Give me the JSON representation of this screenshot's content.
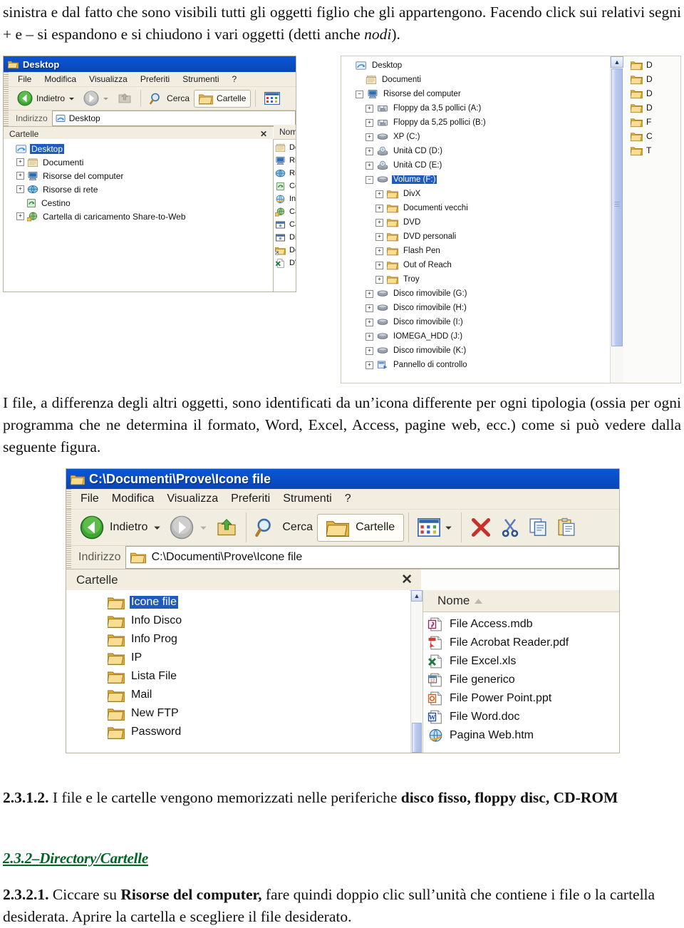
{
  "document": {
    "paragraph1": "sinistra e dal fatto che sono visibili tutti gli oggetti figlio che gli appartengono. Facendo click sui relativi segni + e – si espandono e si chiudono i vari oggetti (detti anche ",
    "paragraph1_italic": "nodi",
    "paragraph1_end": ").",
    "paragraph2_a": "I file, a differenza degli altri oggetti, sono identificati da un’icona differente per ogni tipologia (ossia per ogni programma che ne determina il formato, Word, Excel, Access, pagine web, ecc.) come si può vedere dalla seguente figura.",
    "clause_2312_num": "2.3.1.2.",
    "clause_2312_text": " I file e le cartelle vengono memorizzati nelle periferiche ",
    "clause_2312_bold": "disco fisso, floppy disc, CD-ROM",
    "heading_232": "2.3.2–Directory/Cartelle",
    "heading_232_color": "#006622",
    "clause_2321_num": "2.3.2.1.",
    "clause_2321_a": " Ciccare su ",
    "clause_2321_bold": "Risorse del computer,",
    "clause_2321_b": " fare quindi doppio clic sull’unità che contiene i file o la cartella desiderata. Aprire la cartella e scegliere il file desiderato."
  },
  "figure1": {
    "title": "Desktop",
    "menu": [
      "File",
      "Modifica",
      "Visualizza",
      "Preferiti",
      "Strumenti",
      "?"
    ],
    "toolbar": {
      "back": "Indietro",
      "search": "Cerca",
      "folders": "Cartelle"
    },
    "address": {
      "label": "Indirizzo",
      "value": "Desktop"
    },
    "pane_title": "Cartelle",
    "close_label": "✕",
    "column_header": "Nom",
    "tree": [
      {
        "label": "Desktop",
        "indent": 0,
        "toggle": "none",
        "icon": "desktop-icon",
        "selected": true
      },
      {
        "label": "Documenti",
        "indent": 1,
        "toggle": "+",
        "icon": "documents-icon",
        "selected": false
      },
      {
        "label": "Risorse del computer",
        "indent": 1,
        "toggle": "+",
        "icon": "mycomputer-icon",
        "selected": false
      },
      {
        "label": "Risorse di rete",
        "indent": 1,
        "toggle": "+",
        "icon": "network-icon",
        "selected": false
      },
      {
        "label": "Cestino",
        "indent": 1,
        "toggle": "none",
        "icon": "recyclebin-icon",
        "selected": false
      },
      {
        "label": "Cartella di caricamento Share-to-Web",
        "indent": 1,
        "toggle": "+",
        "icon": "sharetoweb-icon",
        "selected": false
      }
    ],
    "clipped_list": [
      {
        "label": "Do",
        "icon": "documents-icon"
      },
      {
        "label": "Ris",
        "icon": "mycomputer-icon"
      },
      {
        "label": "Ris",
        "icon": "network-icon"
      },
      {
        "label": "Ce",
        "icon": "recyclebin-icon"
      },
      {
        "label": "Int",
        "icon": "internet-icon"
      },
      {
        "label": "Ca",
        "icon": "sharetoweb-icon"
      },
      {
        "label": "Ca",
        "icon": "shortcut-window-icon"
      },
      {
        "label": "Dis",
        "icon": "shortcut-window-icon"
      },
      {
        "label": "Do",
        "icon": "folder-shortcut-icon"
      },
      {
        "label": "DV",
        "icon": "excel-icon"
      }
    ]
  },
  "figure2": {
    "tree": [
      {
        "label": "Desktop",
        "indent": 0,
        "toggle": "none",
        "icon": "desktop-icon",
        "selected": false
      },
      {
        "label": "Documenti",
        "indent": 1,
        "toggle": "none",
        "icon": "documents-icon",
        "selected": false
      },
      {
        "label": "Risorse del computer",
        "indent": 1,
        "toggle": "-",
        "icon": "mycomputer-icon",
        "selected": false
      },
      {
        "label": "Floppy da 3,5 pollici (A:)",
        "indent": 2,
        "toggle": "+",
        "icon": "floppy-icon",
        "selected": false
      },
      {
        "label": "Floppy da 5,25 pollici (B:)",
        "indent": 2,
        "toggle": "+",
        "icon": "floppy-icon",
        "selected": false
      },
      {
        "label": "XP (C:)",
        "indent": 2,
        "toggle": "+",
        "icon": "harddisk-icon",
        "selected": false
      },
      {
        "label": "Unità CD (D:)",
        "indent": 2,
        "toggle": "+",
        "icon": "cddrive-icon",
        "selected": false
      },
      {
        "label": "Unità CD (E:)",
        "indent": 2,
        "toggle": "+",
        "icon": "cddrive-icon",
        "selected": false
      },
      {
        "label": "Volume (F:)",
        "indent": 2,
        "toggle": "-",
        "icon": "harddisk-icon",
        "selected": true
      },
      {
        "label": "DivX",
        "indent": 3,
        "toggle": "+",
        "icon": "folder-icon",
        "selected": false
      },
      {
        "label": "Documenti vecchi",
        "indent": 3,
        "toggle": "+",
        "icon": "folder-icon",
        "selected": false
      },
      {
        "label": "DVD",
        "indent": 3,
        "toggle": "+",
        "icon": "folder-icon",
        "selected": false
      },
      {
        "label": "DVD personali",
        "indent": 3,
        "toggle": "+",
        "icon": "folder-icon",
        "selected": false
      },
      {
        "label": "Flash Pen",
        "indent": 3,
        "toggle": "+",
        "icon": "folder-icon",
        "selected": false
      },
      {
        "label": "Out of Reach",
        "indent": 3,
        "toggle": "+",
        "icon": "folder-icon",
        "selected": false
      },
      {
        "label": "Troy",
        "indent": 3,
        "toggle": "+",
        "icon": "folder-icon",
        "selected": false
      },
      {
        "label": "Disco rimovibile (G:)",
        "indent": 2,
        "toggle": "+",
        "icon": "harddisk-icon",
        "selected": false
      },
      {
        "label": "Disco rimovibile (H:)",
        "indent": 2,
        "toggle": "+",
        "icon": "harddisk-icon",
        "selected": false
      },
      {
        "label": "Disco rimovibile (I:)",
        "indent": 2,
        "toggle": "+",
        "icon": "harddisk-icon",
        "selected": false
      },
      {
        "label": "IOMEGA_HDD (J:)",
        "indent": 2,
        "toggle": "+",
        "icon": "harddisk-icon",
        "selected": false
      },
      {
        "label": "Disco rimovibile (K:)",
        "indent": 2,
        "toggle": "+",
        "icon": "harddisk-icon",
        "selected": false
      },
      {
        "label": "Pannello di controllo",
        "indent": 2,
        "toggle": "+",
        "icon": "controlpanel-icon",
        "selected": false
      }
    ],
    "clipped_list": [
      {
        "label": "D",
        "icon": "folder-icon"
      },
      {
        "label": "D",
        "icon": "folder-icon"
      },
      {
        "label": "D",
        "icon": "folder-icon"
      },
      {
        "label": "D",
        "icon": "folder-icon"
      },
      {
        "label": "F",
        "icon": "folder-icon"
      },
      {
        "label": "C",
        "icon": "folder-icon"
      },
      {
        "label": "T",
        "icon": "folder-icon"
      }
    ]
  },
  "figure3": {
    "title": "C:\\Documenti\\Prove\\Icone file",
    "menu": [
      "File",
      "Modifica",
      "Visualizza",
      "Preferiti",
      "Strumenti",
      "?"
    ],
    "toolbar": {
      "back": "Indietro",
      "search": "Cerca",
      "folders": "Cartelle"
    },
    "address": {
      "label": "Indirizzo",
      "value": "C:\\Documenti\\Prove\\Icone file"
    },
    "pane_title": "Cartelle",
    "close_label": "✕",
    "column_header": "Nome",
    "tree": [
      {
        "label": "Icone file",
        "icon": "folder-icon",
        "selected": true
      },
      {
        "label": "Info Disco",
        "icon": "folder-icon",
        "selected": false
      },
      {
        "label": "Info Prog",
        "icon": "folder-icon",
        "selected": false
      },
      {
        "label": "IP",
        "icon": "folder-icon",
        "selected": false
      },
      {
        "label": "Lista File",
        "icon": "folder-icon",
        "selected": false
      },
      {
        "label": "Mail",
        "icon": "folder-icon",
        "selected": false
      },
      {
        "label": "New FTP",
        "icon": "folder-icon",
        "selected": false
      },
      {
        "label": "Password",
        "icon": "folder-icon",
        "selected": false
      }
    ],
    "files": [
      {
        "label": "File Access.mdb",
        "icon": "access-icon"
      },
      {
        "label": "File Acrobat Reader.pdf",
        "icon": "pdf-icon"
      },
      {
        "label": "File Excel.xls",
        "icon": "excel-icon"
      },
      {
        "label": "File generico",
        "icon": "generic-file-icon"
      },
      {
        "label": "File Power Point.ppt",
        "icon": "powerpoint-icon"
      },
      {
        "label": "File Word.doc",
        "icon": "word-icon"
      },
      {
        "label": "Pagina Web.htm",
        "icon": "internet-icon"
      }
    ]
  }
}
